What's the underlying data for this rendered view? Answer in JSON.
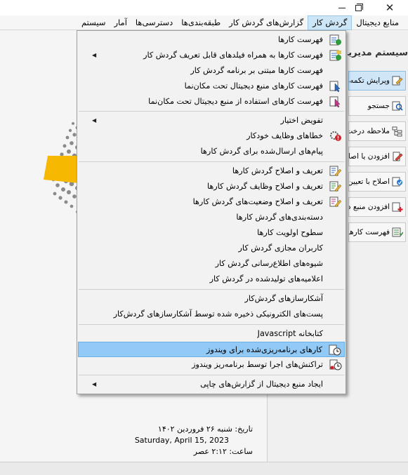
{
  "window": {
    "min_icon": "minimize-icon",
    "max_icon": "maximize-icon",
    "close_icon": "close-icon",
    "close_glyph": "✕"
  },
  "menubar": {
    "items": [
      {
        "label": "منابع دیجیتال"
      },
      {
        "label": "گردش کار"
      },
      {
        "label": "گزارش‌های گردش کار"
      },
      {
        "label": "طبقه‌بندی‌ها"
      },
      {
        "label": "دسترسی‌ها"
      },
      {
        "label": "آمار"
      },
      {
        "label": "سیستم"
      }
    ]
  },
  "dropdown": {
    "items": [
      {
        "label": "فهرست کارها",
        "icon": "task-list-icon"
      },
      {
        "label": "فهرست کارها به همراه فیلدهای قابل تعریف گردش کار",
        "icon": "task-list-fields-icon",
        "submenu": true
      },
      {
        "label": "فهرست کارها مبتنی بر برنامه گردش کار",
        "icon": ""
      },
      {
        "label": "فهرست کارهای منبع دیجیتال تحت مکان‌نما",
        "icon": "task-cursor-icon"
      },
      {
        "label": "فهرست کارهای استفاده از منبع دیجیتال تحت مکان‌نما",
        "icon": "task-usage-cursor-icon"
      },
      {
        "label": "تفویض اختیار",
        "icon": "",
        "submenu": true
      },
      {
        "label": "خطاهای وظایف خودکار",
        "icon": "auto-task-error-icon"
      },
      {
        "label": "پیام‌های ارسال‌شده برای گردش کارها",
        "icon": ""
      },
      {
        "label": "تعریف و اصلاح گردش کارها",
        "icon": "workflow-edit-icon"
      },
      {
        "label": "تعریف و اصلاح وظایف گردش کارها",
        "icon": "workflow-tasks-edit-icon"
      },
      {
        "label": "تعریف و اصلاح وضعیت‌های گردش کارها",
        "icon": "workflow-status-edit-icon"
      },
      {
        "label": "دسته‌بندی‌های گردش کارها",
        "icon": ""
      },
      {
        "label": "سطوح اولویت کارها",
        "icon": ""
      },
      {
        "label": "کاربران مجازی گردش کار",
        "icon": ""
      },
      {
        "label": "شیوه‌های اطلاع‌رسانی گردش کار",
        "icon": ""
      },
      {
        "label": "اعلامیه‌های تولیدشده در گردش کار",
        "icon": ""
      },
      {
        "label": "آشکارسازهای گردش‌کار",
        "icon": ""
      },
      {
        "label": "پست‌های الکترونیکی ذخیره شده توسط آشکارسازهای گردش‌کار",
        "icon": ""
      },
      {
        "label": "کتابخانه Javascript",
        "icon": ""
      },
      {
        "label": "کارهای برنامه‌ریزی‌شده برای ویندوز",
        "icon": "scheduled-task-icon",
        "highlighted": true
      },
      {
        "label": "تراکنش‌های اجرا توسط برنامه‌ریز ویندوز",
        "icon": "scheduler-transactions-icon"
      },
      {
        "label": "ایجاد منبع دیجیتال از گزارش‌های چاپی",
        "icon": "",
        "submenu": true
      }
    ]
  },
  "sidebar": {
    "header": "سیستم مدیریت",
    "buttons": [
      {
        "label": "ویرایش تکمه‌ها",
        "icon": "edit-buttons-icon"
      },
      {
        "label": "جستجو",
        "icon": "search-icon"
      },
      {
        "label": "ملاحظه درخت",
        "icon": "tree-view-icon"
      },
      {
        "label": "افزودن یا اصلاح",
        "icon": "add-edit-icon"
      },
      {
        "label": "اصلاح با تعیین",
        "icon": "edit-specify-icon"
      },
      {
        "label": "افزودن منبع دیجیتال",
        "icon": "add-resource-icon"
      },
      {
        "label": "فهرست کارها",
        "icon": "task-list-icon"
      }
    ]
  },
  "status": {
    "date_label": "تاریخ:",
    "date_value": "شنبه ۲۶ فروردین ۱۴۰۲",
    "gregorian": "Saturday, April 15, 2023",
    "time_label": "ساعت:",
    "time_value": "۲:۱۲ عصر"
  },
  "colors": {
    "highlight": "#91c9f7",
    "menubar_active": "#cde6f7",
    "logo_yellow": "#f6b800"
  }
}
